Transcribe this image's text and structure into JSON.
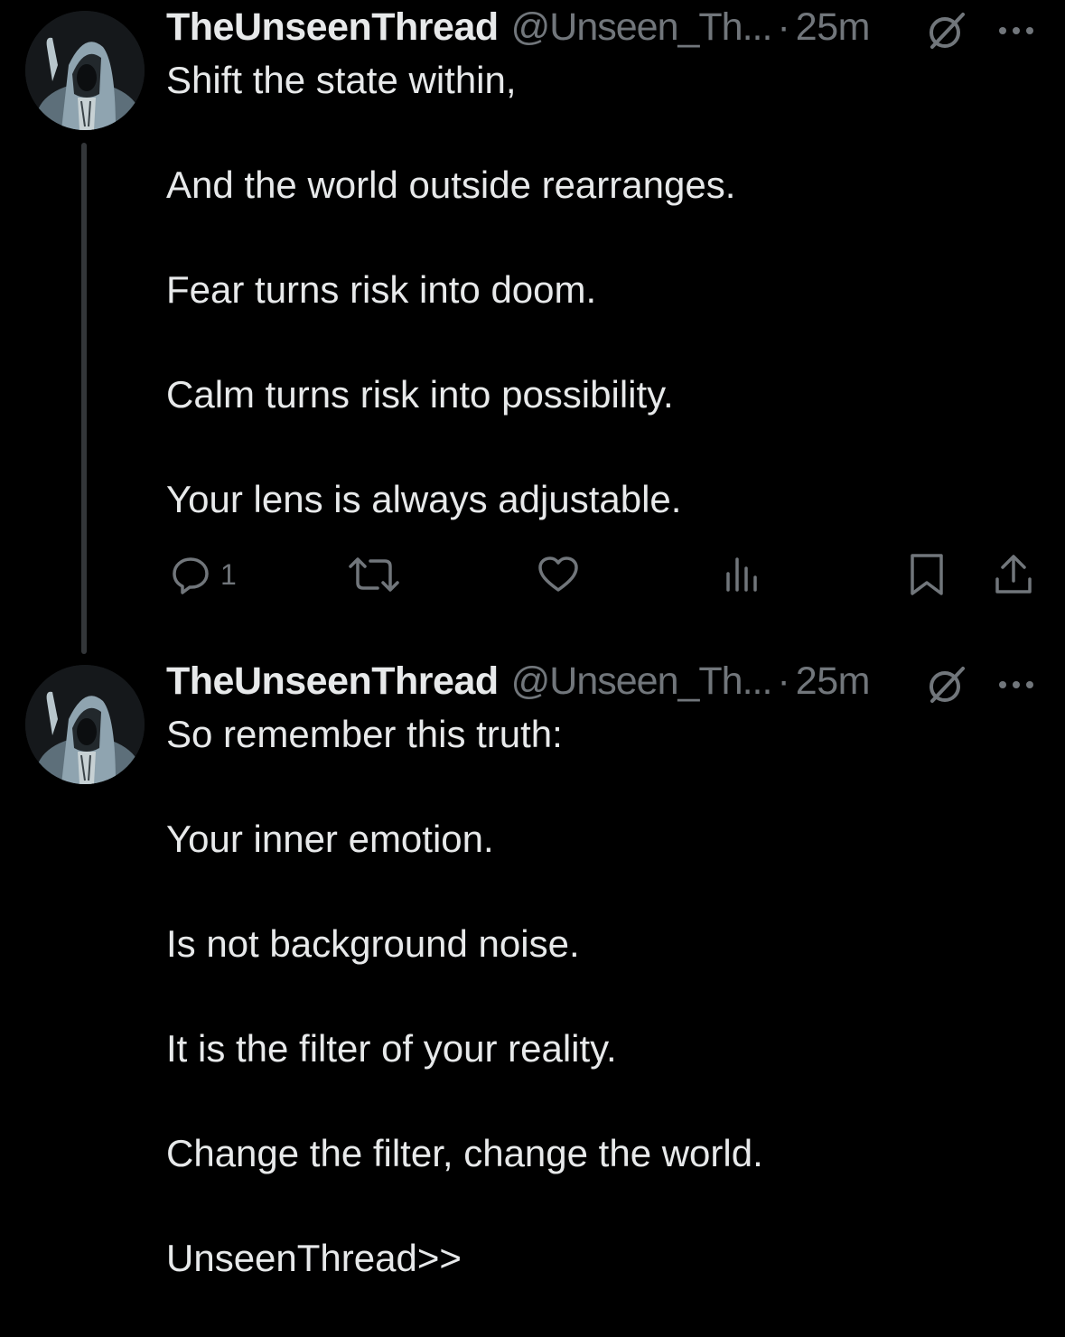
{
  "tweets": [
    {
      "display_name": "TheUnseenThread",
      "handle": "@Unseen_Th...",
      "separator": "·",
      "time": "25m",
      "lines": [
        "Shift the state within,",
        "And the world outside rearranges.",
        "Fear turns risk into doom.",
        "Calm turns risk into possibility.",
        "Your lens is always adjustable."
      ],
      "actions": {
        "reply_count": "1"
      }
    },
    {
      "display_name": "TheUnseenThread",
      "handle": "@Unseen_Th...",
      "separator": "·",
      "time": "25m",
      "lines": [
        "So remember this truth:",
        "Your inner emotion.",
        "Is not background noise.",
        "It is the filter of your reality.",
        "Change the filter, change the world.",
        "UnseenThread>>"
      ]
    }
  ],
  "icons": {
    "avatar": "hooded-figure-avatar",
    "grok": "grok-icon",
    "more": "more-icon",
    "reply": "reply-icon",
    "retweet": "retweet-icon",
    "like": "heart-icon",
    "views": "views-icon",
    "bookmark": "bookmark-icon",
    "share": "share-icon"
  },
  "colors": {
    "background": "#000000",
    "primary_text": "#e7e9ea",
    "secondary_text": "#71767b",
    "thread_line": "#333639"
  }
}
